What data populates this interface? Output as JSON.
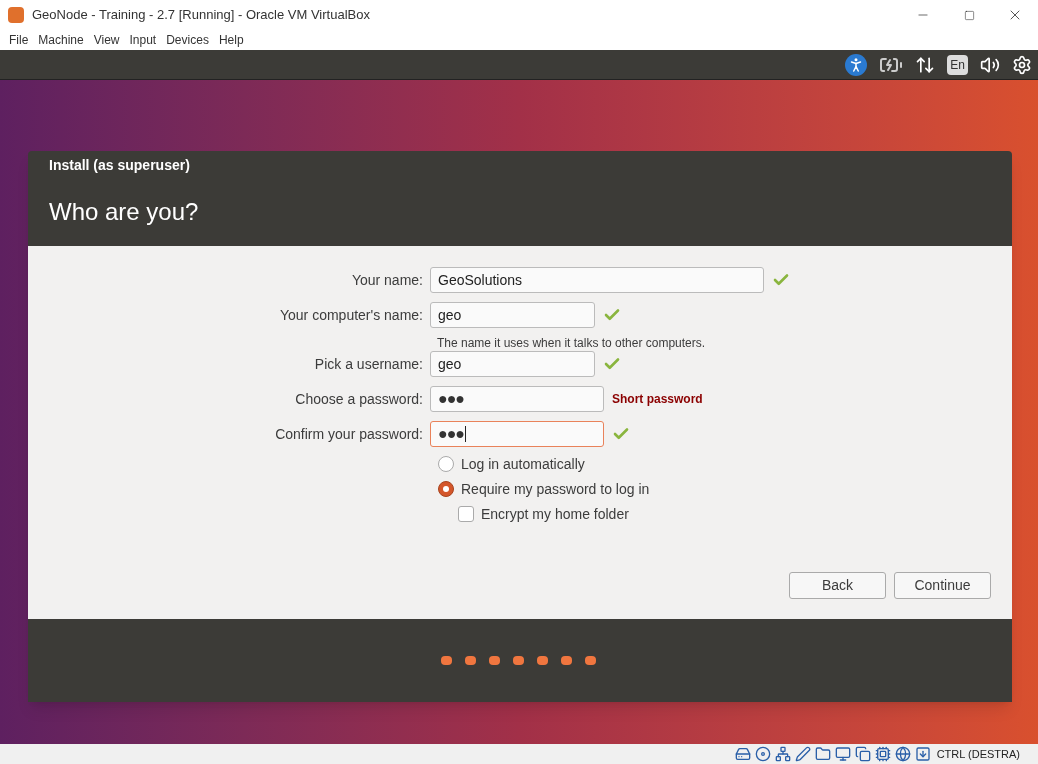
{
  "window": {
    "title": "GeoNode - Training - 2.7 [Running] - Oracle VM VirtualBox"
  },
  "menu": [
    "File",
    "Machine",
    "View",
    "Input",
    "Devices",
    "Help"
  ],
  "top_panel": {
    "keyboard_layout": "En"
  },
  "dialog": {
    "title": "Install (as superuser)",
    "heading": "Who are you?",
    "fields": [
      {
        "label": "Your name:",
        "value": "GeoSolutions",
        "kind": "text",
        "valid": true,
        "focused": false
      },
      {
        "label": "Your computer's name:",
        "value": "geo",
        "kind": "text",
        "valid": true,
        "focused": false,
        "hint": "The name it uses when it talks to other computers."
      },
      {
        "label": "Pick a username:",
        "value": "geo",
        "kind": "text",
        "valid": true,
        "focused": false
      },
      {
        "label": "Choose a password:",
        "value": "●●●",
        "kind": "password",
        "valid": false,
        "focused": false,
        "warning": "Short password"
      },
      {
        "label": "Confirm your password:",
        "value": "●●●",
        "kind": "password",
        "valid": true,
        "focused": true
      }
    ],
    "login_options": [
      {
        "label": "Log in automatically",
        "selected": false
      },
      {
        "label": "Require my password to log in",
        "selected": true
      }
    ],
    "encrypt": {
      "label": "Encrypt my home folder",
      "checked": false
    },
    "buttons": [
      "Back",
      "Continue"
    ]
  },
  "status_bar": {
    "host_key": "CTRL (DESTRA)"
  }
}
